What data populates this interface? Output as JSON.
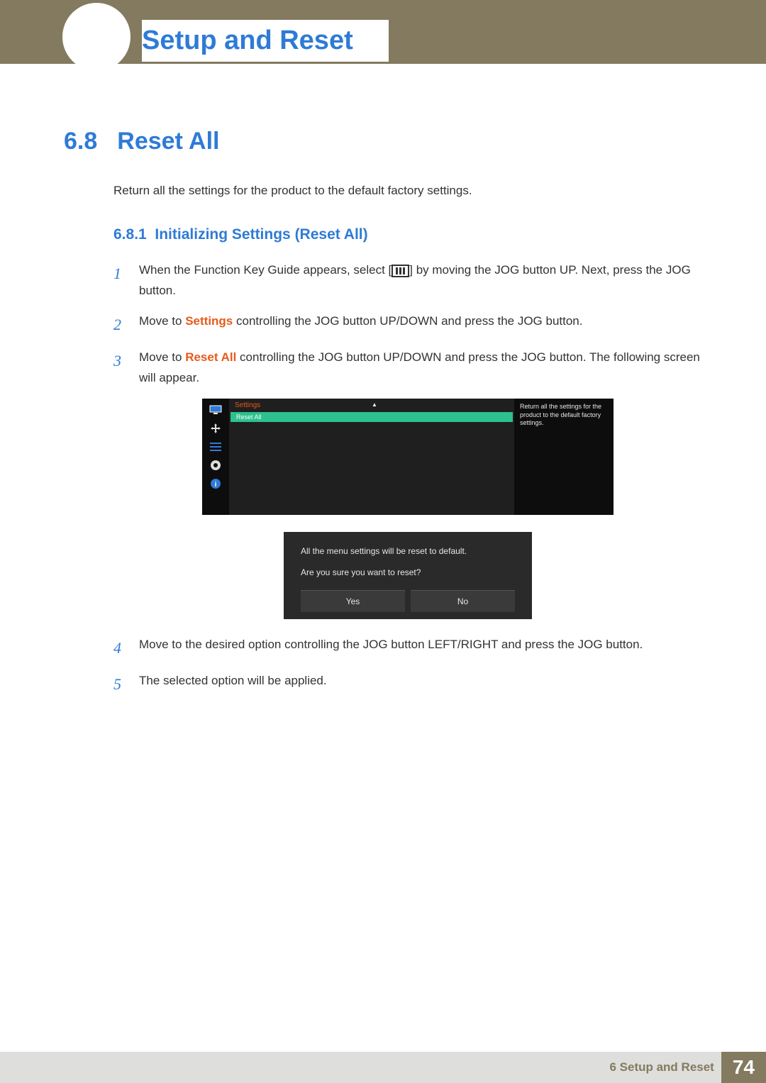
{
  "header": {
    "chapter_title": "Setup and Reset"
  },
  "section": {
    "number": "6.8",
    "title": "Reset All",
    "intro": "Return all the settings for the product to the default factory settings."
  },
  "subsection": {
    "number": "6.8.1",
    "title": "Initializing Settings (Reset All)"
  },
  "steps": {
    "s1": {
      "num": "1",
      "pre": "When the Function Key Guide appears, select [",
      "post": "] by moving the JOG button UP. Next, press the JOG button."
    },
    "s2": {
      "num": "2",
      "pre": "Move to ",
      "hl": "Settings",
      "post": " controlling the JOG button UP/DOWN and press the JOG button."
    },
    "s3": {
      "num": "3",
      "pre": "Move to ",
      "hl": "Reset All",
      "post": " controlling the JOG button UP/DOWN and press the JOG button. The following screen will appear."
    },
    "s4": {
      "num": "4",
      "text": "Move to the desired option controlling the JOG button LEFT/RIGHT and press the JOG button."
    },
    "s5": {
      "num": "5",
      "text": "The selected option will be applied."
    }
  },
  "osd1": {
    "header": "Settings",
    "row": "Reset All",
    "tip": "Return all the settings for the product to the default factory settings."
  },
  "dialog": {
    "msg": "All the menu settings will be reset to default.",
    "q": "Are you sure you want to reset?",
    "yes": "Yes",
    "no": "No"
  },
  "footer": {
    "text": "6 Setup and Reset",
    "page": "74"
  }
}
